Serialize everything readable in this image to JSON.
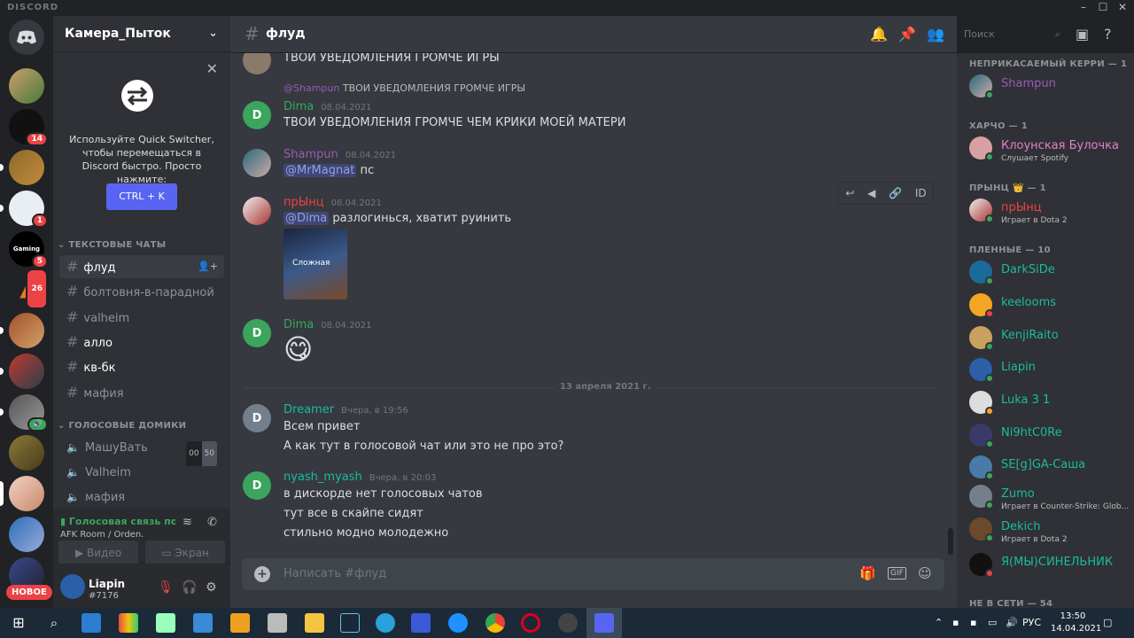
{
  "window": {
    "brand": "DISCORD"
  },
  "servers": {
    "badges": [
      "14",
      "1",
      "5",
      "26"
    ],
    "new_label": "НОВОЕ"
  },
  "guild": {
    "name": "Камера_Пыток"
  },
  "quick_switcher": {
    "text": "Используйте Quick Switcher, чтобы перемещаться в Discord быстро. Просто нажмите:",
    "button": "CTRL + K"
  },
  "channels": {
    "text_category": "ТЕКСТОВЫЕ ЧАТЫ",
    "text": [
      "флуд",
      "болтовня-в-парадной",
      "valheim",
      "алло",
      "кв-бк",
      "мафия"
    ],
    "voice_category": "ГОЛОСОВЫЕ ДОМИКИ",
    "voice": [
      "МашуВать",
      "Valheim",
      "мафия"
    ],
    "voice_count": {
      "current": "00",
      "limit": "50"
    }
  },
  "voice_status": {
    "title": "Голосовая связь подключена",
    "sub": "AFK Room / Orden.",
    "video": "Видео",
    "screen": "Экран"
  },
  "user": {
    "name": "Liapin",
    "tag": "#7176"
  },
  "header": {
    "channel": "флуд",
    "search_placeholder": "Поиск"
  },
  "messages": {
    "m0_text": "ТВОИ УВЕДОМЛЕНИЯ ГРОМЧЕ ИГРЫ",
    "reply_user": "@Shampun",
    "reply_text": "ТВОИ УВЕДОМЛЕНИЯ ГРОМЧЕ ИГРЫ",
    "m1_user": "Dima",
    "m1_time": "08.04.2021",
    "m1_text": "ТВОИ УВЕДОМЛЕНИЯ ГРОМЧЕ ЧЕМ КРИКИ МОЕЙ МАТЕРИ",
    "m2_user": "Shampun",
    "m2_time": "08.04.2021",
    "m2_mention": "@MrMagnat",
    "m2_text": "пс",
    "m3_user": "прЫнц",
    "m3_time": "08.04.2021",
    "m3_mention": "@Dima",
    "m3_text": "разлогинься, хватит руинить",
    "m3_image_caption": "Сложная",
    "m4_user": "Dima",
    "m4_time": "08.04.2021",
    "m4_emoji": "😋",
    "date_divider": "13 апреля 2021 г.",
    "m5_user": "Dreamer",
    "m5_time": "Вчера, в 19:56",
    "m5_line1": "Всем привет",
    "m5_line2": "А как тут в голосовой чат или это не про это?",
    "m6_user": "nyash_myash",
    "m6_time": "Вчера, в 20:03",
    "m6_line1": "в дискорде нет голосовых чатов",
    "m6_line2": "тут все в скайпе сидят",
    "m6_line3": "стильно модно молодежно"
  },
  "composer": {
    "placeholder": "Написать #флуд",
    "gif": "GIF"
  },
  "members": {
    "g1": "НЕПРИКАСАЕМЫЙ КЕРРИ — 1",
    "g2": "ХАРЧО — 1",
    "g3": "ПРЫНЦ 👑 — 1",
    "g4": "ПЛЕННЫЕ — 10",
    "g5": "НЕ В СЕТИ — 54",
    "list": [
      {
        "name": "Shampun",
        "activity": ""
      },
      {
        "name": "Клоунская Булочка",
        "activity": "Слушает Spotify"
      },
      {
        "name": "прЫнц",
        "activity": "Играет в Dota 2"
      },
      {
        "name": "DarkSiDe",
        "activity": ""
      },
      {
        "name": "keelooms",
        "activity": ""
      },
      {
        "name": "KenjiRaito",
        "activity": ""
      },
      {
        "name": "Liapin",
        "activity": ""
      },
      {
        "name": "Luka 3 1",
        "activity": ""
      },
      {
        "name": "Ni9htC0Re",
        "activity": ""
      },
      {
        "name": "SE[g]GA-Саша",
        "activity": ""
      },
      {
        "name": "Zumo",
        "activity": "Играет в Counter-Strike: Glob..."
      },
      {
        "name": "Dekich",
        "activity": "Играет в Dota 2"
      },
      {
        "name": "Я(МЫ)СИНЕЛЬНИК",
        "activity": ""
      }
    ]
  },
  "taskbar": {
    "lang": "РУС",
    "time": "13:50",
    "date": "14.04.2021"
  },
  "colors": {
    "accent": "#5865f2",
    "online": "#3ba55d",
    "dnd": "#ed4245",
    "dima": "#3ba55d",
    "shampun": "#9b59b6",
    "prync": "#ed4245",
    "teal": "#1abc9c"
  }
}
